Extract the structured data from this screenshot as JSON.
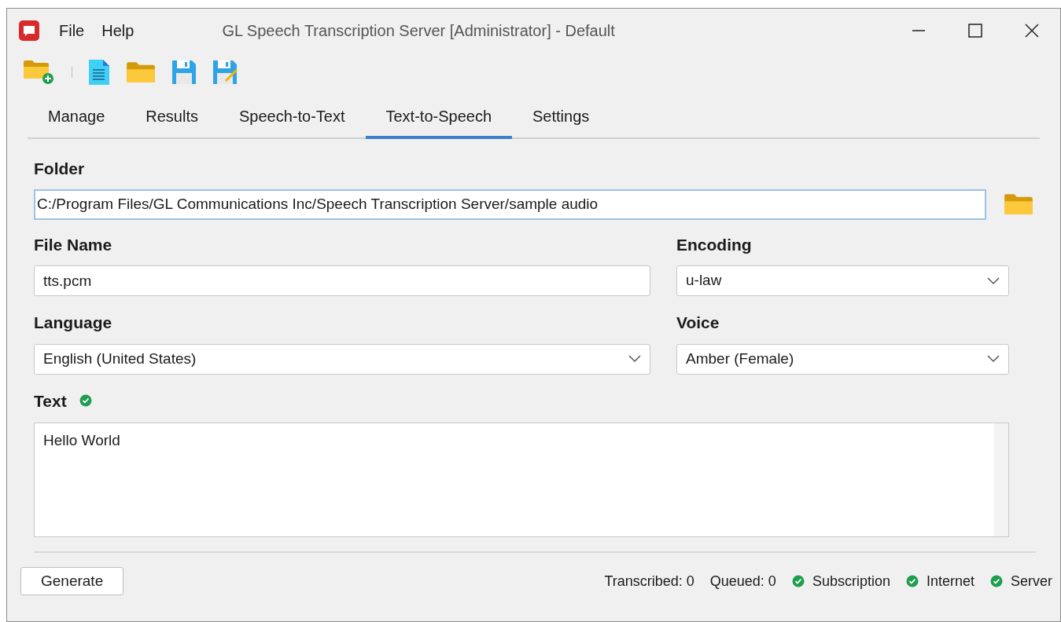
{
  "window": {
    "title": "GL Speech Transcription Server [Administrator] - Default"
  },
  "menu": [
    "File",
    "Help"
  ],
  "tabs": [
    {
      "label": "Manage",
      "selected": false
    },
    {
      "label": "Results",
      "selected": false
    },
    {
      "label": "Speech-to-Text",
      "selected": false
    },
    {
      "label": "Text-to-Speech",
      "selected": true
    },
    {
      "label": "Settings",
      "selected": false
    }
  ],
  "folder": {
    "label": "Folder",
    "value": "C:/Program Files/GL Communications Inc/Speech Transcription Server/sample audio",
    "focused": true
  },
  "file_name": {
    "label": "File Name",
    "value": "tts.pcm"
  },
  "encoding": {
    "label": "Encoding",
    "value": "u-law"
  },
  "language": {
    "label": "Language",
    "value": "English (United States)"
  },
  "voice": {
    "label": "Voice",
    "value": "Amber (Female)"
  },
  "text": {
    "label": "Text",
    "valid": true,
    "value": "Hello World"
  },
  "generate_button": "Generate",
  "status_bar": {
    "counters": [
      "Transcribed: 0",
      "Queued: 0"
    ],
    "indicators": [
      {
        "label": "Subscription",
        "ok": true
      },
      {
        "label": "Internet",
        "ok": true
      },
      {
        "label": "Server",
        "ok": true
      }
    ]
  }
}
